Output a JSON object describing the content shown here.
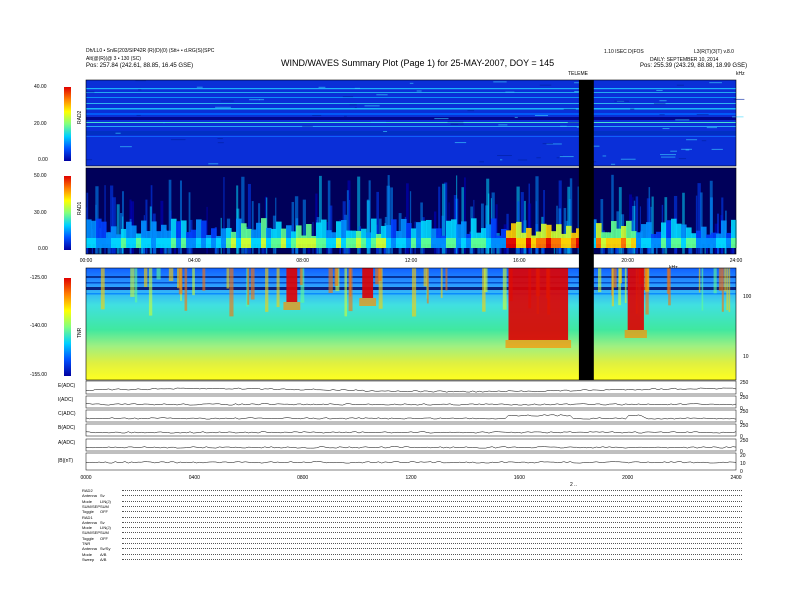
{
  "header": {
    "left_line1": "Dh/LL0 • Sn/E(203/SIP42R (R)(D)(0) (Stt+ • d.RG(S)(SPC",
    "left_line2": "Alt(@(R)(@ 3 • 130 (SC)",
    "left_pos": "Pos:   257.84 (242.61, 88.85, 16.45 GSE)",
    "title": "WIND/WAVES Summary Plot (Page 1) for 25-MAY-2007, DOY = 145",
    "right_line1": "1.10 ISEC D(FOS",
    "right_line2": "L3(R(T)(3(T) v.8.0",
    "right_line3": "DAILY: SEPTEMBER 10, 2014",
    "right_pos": "Pos:   255.39 (243.29, 88.88, 18.99 GSE)",
    "gap_label": "TELEME",
    "corner_mark": "kHz"
  },
  "chart_data": [
    {
      "type": "heatmap",
      "name": "RAD2",
      "ylabel": "RAD2",
      "y_ticks": [
        "40.00",
        "20.00",
        "0.00"
      ],
      "ylim": [
        0,
        40
      ],
      "color_scale": [
        "#0000a0",
        "#0050ff",
        "#00d0ff",
        "#80ff80",
        "#ffff00",
        "#ff8000",
        "#e00000"
      ]
    },
    {
      "type": "heatmap",
      "name": "RAD1",
      "ylabel": "RAD1",
      "y_ticks": [
        "50.00",
        "30.00",
        "0.00"
      ],
      "ylim": [
        0,
        50
      ],
      "x_ticks": [
        "00:00",
        "04:00",
        "08:00",
        "12:00",
        "16:00",
        "20:00",
        "24:00"
      ],
      "x_range_hours": [
        0,
        24
      ],
      "data_gap_hours": [
        18.2,
        18.75
      ]
    },
    {
      "type": "heatmap",
      "name": "TNR",
      "ylabel": "TNR",
      "y_ticks": [
        "-125.00",
        "-140.00",
        "-155.00"
      ],
      "ylim": [
        -155,
        -125
      ],
      "right_axis_label": "kHz",
      "right_ticks": [
        "100",
        "10"
      ]
    },
    {
      "type": "line",
      "panels": [
        "E(ADC)",
        "I(ADC)",
        "C(ADC)",
        "B(ADC)",
        "A(ADC)",
        "|B|(nT)"
      ],
      "right_ticks": [
        [
          "250",
          "0"
        ],
        [
          "250",
          "0"
        ],
        [
          "250",
          "0"
        ],
        [
          "250",
          "0"
        ],
        [
          "250",
          "0"
        ],
        [
          "20",
          "10",
          "0"
        ]
      ],
      "x_ticks": [
        "0000",
        "0400",
        "0800",
        "1200",
        "1600",
        "2000",
        "2400"
      ]
    }
  ],
  "footer": {
    "mark": "2 ..",
    "rows": [
      {
        "label": "RAD2",
        "value": ""
      },
      {
        "label": "Antenna",
        "value": "Sv"
      },
      {
        "label": "Mode",
        "value": "LIN(J)"
      },
      {
        "label": "SUM/SEP",
        "value": "SUM"
      },
      {
        "label": "Toggle",
        "value": "OFF"
      },
      {
        "label": "RAD1",
        "value": ""
      },
      {
        "label": "Antenna",
        "value": "Sv"
      },
      {
        "label": "Mode",
        "value": "LIN(J)"
      },
      {
        "label": "SUM/SEP",
        "value": "SUM"
      },
      {
        "label": "Toggle",
        "value": "OFF"
      },
      {
        "label": "TNR",
        "value": ""
      },
      {
        "label": "Antenna",
        "value": "Sv/Sy"
      },
      {
        "label": "Mode",
        "value": "A/B"
      },
      {
        "label": "Sweep",
        "value": "A/B"
      }
    ]
  }
}
